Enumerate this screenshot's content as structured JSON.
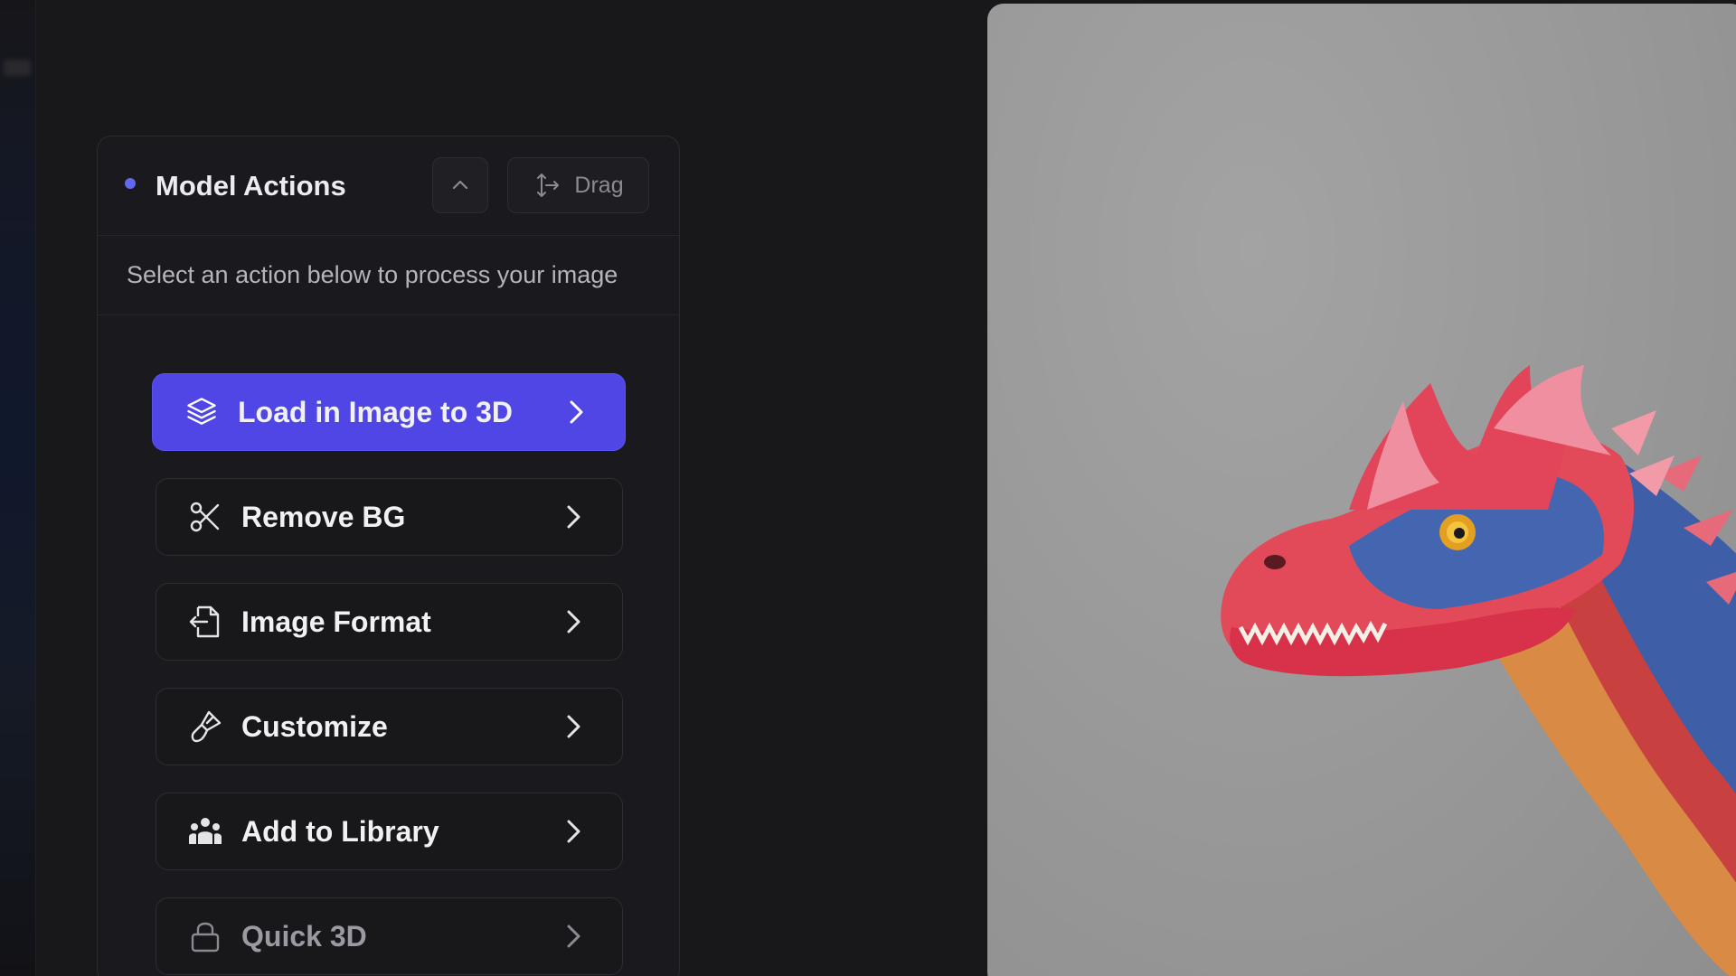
{
  "panel": {
    "title": "Model Actions",
    "drag_label": "Drag",
    "subtitle": "Select an action below to process your image"
  },
  "actions": [
    {
      "label": "Load in Image to 3D",
      "icon": "layers-icon",
      "state": "primary"
    },
    {
      "label": "Remove BG",
      "icon": "scissors-icon",
      "state": "default"
    },
    {
      "label": "Image Format",
      "icon": "file-export-icon",
      "state": "default"
    },
    {
      "label": "Customize",
      "icon": "paintbrush-icon",
      "state": "default"
    },
    {
      "label": "Add to Library",
      "icon": "users-icon",
      "state": "default"
    },
    {
      "label": "Quick 3D",
      "icon": "lock-icon",
      "state": "disabled"
    }
  ],
  "colors": {
    "accent": "#4f46e5",
    "dot": "#6366f1",
    "background": "#18181b",
    "panel": "#1a1a1e"
  },
  "viewer": {
    "subject": "dinosaur-image"
  }
}
